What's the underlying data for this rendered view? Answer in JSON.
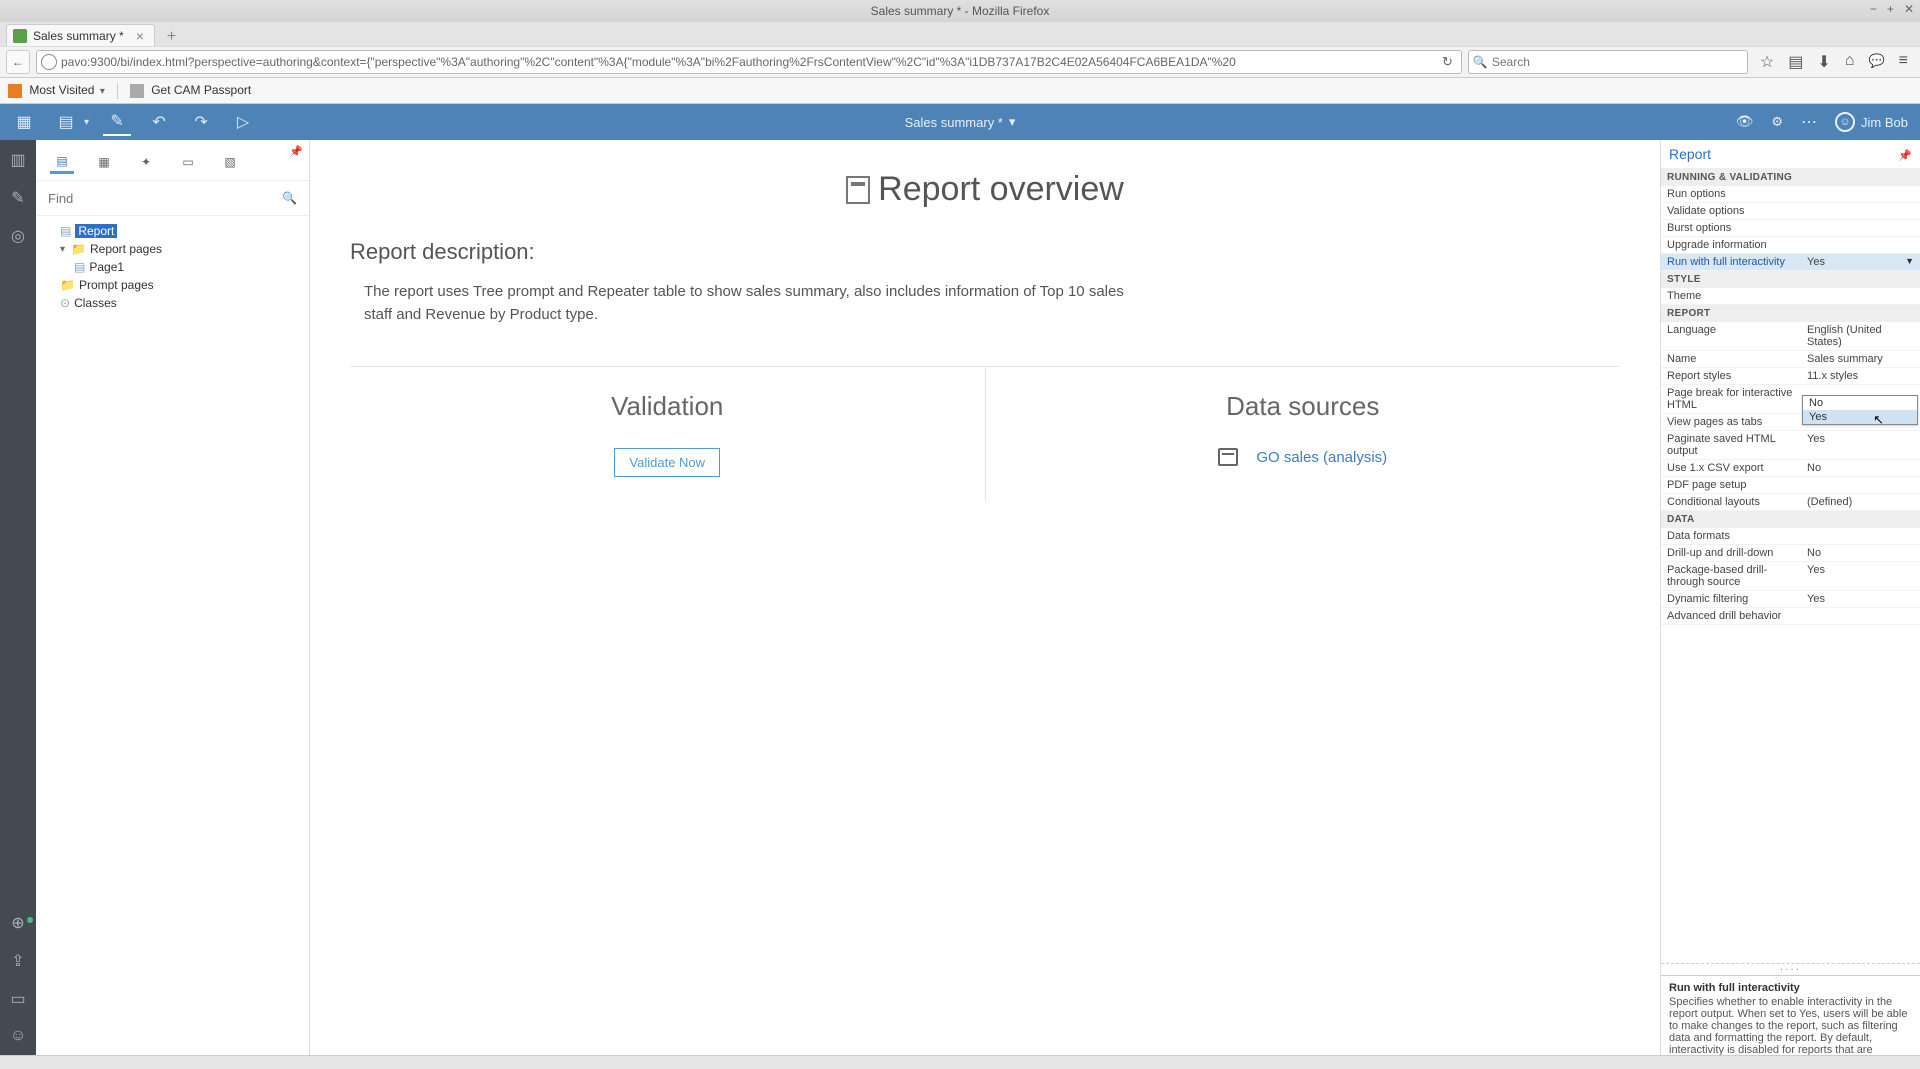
{
  "window": {
    "title": "Sales summary * - Mozilla Firefox"
  },
  "browser": {
    "tab_label": "Sales summary *",
    "url": "pavo:9300/bi/index.html?perspective=authoring&context={\"perspective\"%3A\"authoring\"%2C\"content\"%3A{\"module\"%3A\"bi%2Fauthoring%2FrsContentView\"%2C\"id\"%3A\"i1DB737A17B2C4E02A56404FCA6BEA1DA\"%20",
    "search_placeholder": "Search",
    "bookmarks": {
      "most_visited": "Most Visited",
      "get_cam": "Get CAM Passport"
    }
  },
  "app_toolbar": {
    "doc_title": "Sales summary *",
    "user_name": "Jim Bob"
  },
  "left_panel": {
    "find_placeholder": "Find",
    "tree": {
      "report_label": "Report",
      "report_pages": "Report pages",
      "page1": "Page1",
      "prompt_pages": "Prompt pages",
      "classes": "Classes"
    }
  },
  "canvas": {
    "title": "Report overview",
    "desc_label": "Report description:",
    "desc_text": "The report uses Tree prompt and Repeater table to show sales summary, also includes information of Top 10 sales staff and Revenue by Product type.",
    "validation_heading": "Validation",
    "validate_button": "Validate Now",
    "datasources_heading": "Data sources",
    "datasource_link": "GO sales (analysis)"
  },
  "right_panel": {
    "title": "Report",
    "sections": {
      "running_validating": "RUNNING & VALIDATING",
      "style": "STYLE",
      "report": "REPORT",
      "data": "DATA"
    },
    "props": {
      "run_options": "Run options",
      "validate_options": "Validate options",
      "burst_options": "Burst options",
      "upgrade_info": "Upgrade information",
      "run_full_interactivity": "Run with full interactivity",
      "run_full_interactivity_val": "Yes",
      "theme": "Theme",
      "language": "Language",
      "language_val": "English (United States)",
      "name": "Name",
      "name_val": "Sales summary",
      "report_styles": "Report styles",
      "report_styles_val": "11.x styles",
      "page_break_html": "Page break for interactive HTML",
      "view_tabs": "View pages as tabs",
      "paginate_html": "Paginate saved HTML output",
      "paginate_html_val": "Yes",
      "csv_export": "Use 1.x CSV export",
      "csv_export_val": "No",
      "pdf_setup": "PDF page setup",
      "cond_layouts": "Conditional layouts",
      "cond_layouts_val": "(Defined)",
      "data_formats": "Data formats",
      "drillupdown": "Drill-up and drill-down",
      "drillupdown_val": "No",
      "pkg_drill": "Package-based drill-through source",
      "pkg_drill_val": "Yes",
      "dyn_filter": "Dynamic filtering",
      "dyn_filter_val": "Yes",
      "adv_drill": "Advanced drill behavior"
    },
    "dropdown": {
      "opt_no": "No",
      "opt_yes": "Yes"
    },
    "help": {
      "title": "Run with full interactivity",
      "body": "Specifies whether to enable interactivity in the report output. When set to Yes, users will be able to make changes to the report, such as filtering data and formatting the report. By default, interactivity is disabled for reports that are created in previous"
    }
  }
}
